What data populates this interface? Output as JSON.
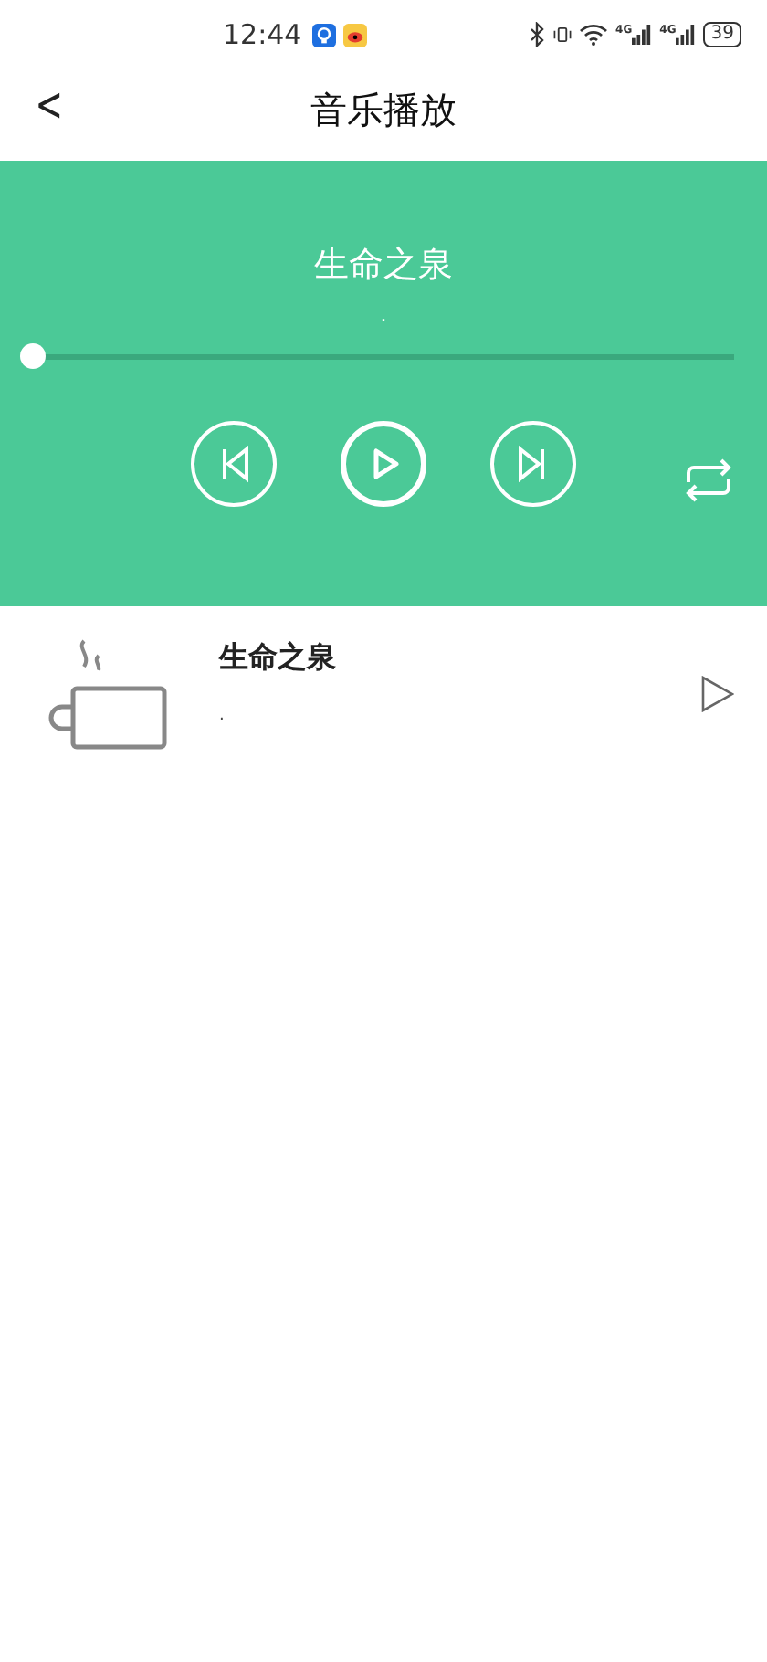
{
  "status_bar": {
    "time": "12:44",
    "signal_labels": [
      "4G",
      "4G"
    ],
    "battery": "39"
  },
  "header": {
    "back": "<",
    "title": "音乐播放"
  },
  "player": {
    "title": "生命之泉",
    "artist": ".",
    "progress": {
      "level": 0
    }
  },
  "playlist": [
    {
      "title": "生命之泉",
      "artist": ".",
      "selected": false
    }
  ]
}
